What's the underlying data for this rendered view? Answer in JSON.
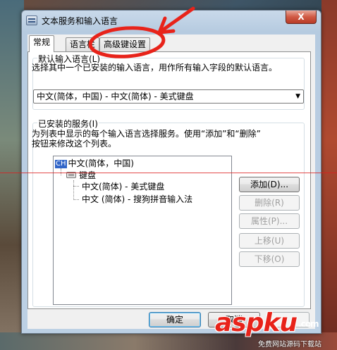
{
  "window": {
    "title": "文本服务和输入语言",
    "close_glyph": "X"
  },
  "tabs": [
    {
      "label": "常规",
      "active": true
    },
    {
      "label": "语言栏",
      "active": false
    },
    {
      "label": "高级键设置",
      "active": false
    }
  ],
  "default_language": {
    "group_label": "默认输入语言(L)",
    "description": "选择其中一个已安装的输入语言，用作所有输入字段的默认语言。",
    "selected": "中文(简体，中国) - 中文(简体) - 美式键盘"
  },
  "installed_services": {
    "group_label": "已安装的服务(I)",
    "description_line1": "为列表中显示的每个输入语言选择服务。使用“添加”和“删除”",
    "description_line2": "按钮来修改这个列表。",
    "tree": {
      "language_badge": "CH",
      "language": "中文(简体，中国)",
      "category": "键盘",
      "items": [
        "中文(简体) - 美式键盘",
        "中文 (简体) - 搜狗拼音输入法"
      ]
    },
    "buttons": {
      "add": "添加(D)...",
      "remove": "删除(R)",
      "properties": "属性(P)...",
      "move_up": "上移(U)",
      "move_down": "下移(O)"
    }
  },
  "footer": {
    "ok": "确定",
    "cancel": "取消"
  },
  "watermark": {
    "brand": "aspku",
    "tld": ".com",
    "tagline": "免费网站源码下载站"
  },
  "colors": {
    "annotation": "#e8231a",
    "language_badge": "#3165c8",
    "titlebar": "#bcd0e4"
  }
}
